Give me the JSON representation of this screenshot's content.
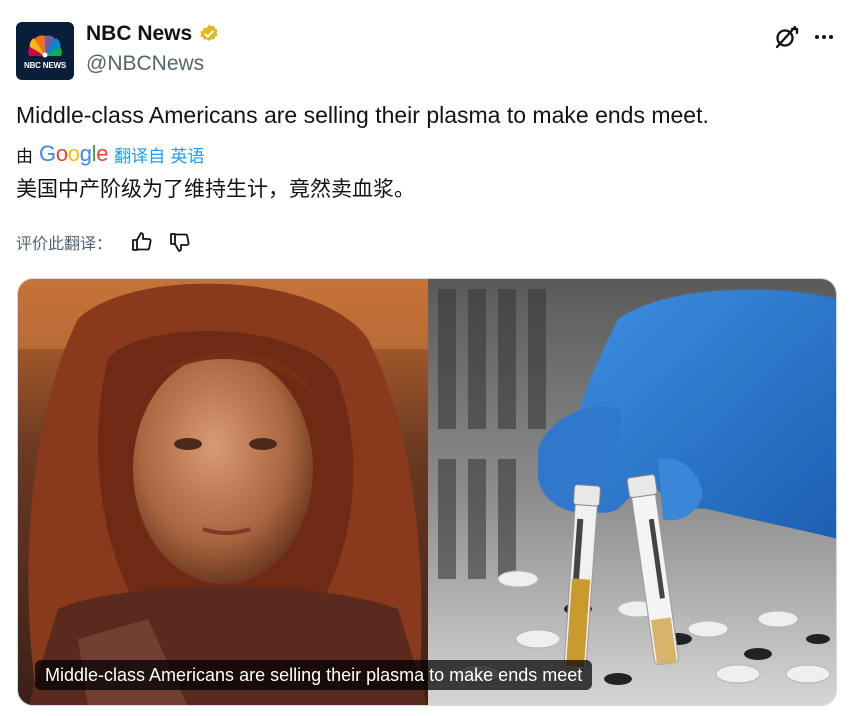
{
  "author": {
    "display_name": "NBC News",
    "handle": "@NBCNews",
    "logo_text": "NBC NEWS",
    "verified_color": "#e2b719"
  },
  "tweet": {
    "text": "Middle-class Americans are selling their plasma to make ends meet."
  },
  "translation": {
    "by_label": "由",
    "provider": "Google",
    "link_label": "翻译自 英语",
    "translated_text": "美国中产阶级为了维持生计，竟然卖血浆。",
    "rate_label": "评价此翻译：",
    "rate_up_icon": "thumbs-up-icon",
    "rate_down_icon": "thumbs-down-icon"
  },
  "media": {
    "caption": "Middle-class Americans are selling their plasma to make ends meet"
  },
  "icons": {
    "grok": "grok-icon",
    "more": "more-icon"
  },
  "colors": {
    "text": "#0f1419",
    "secondary": "#536471",
    "link": "#1d9bf0",
    "google_blue": "#4285f4",
    "google_red": "#ea4335",
    "google_yellow": "#fbbc05",
    "google_green": "#34a853"
  }
}
